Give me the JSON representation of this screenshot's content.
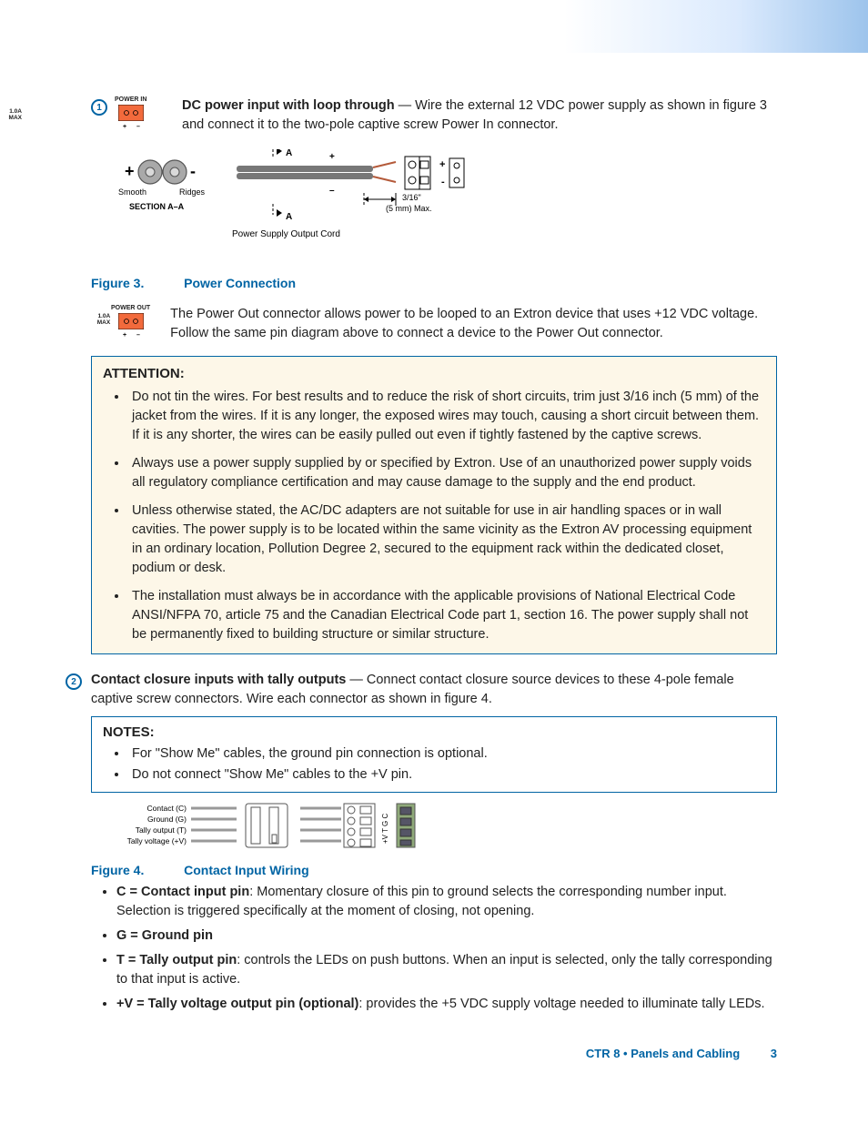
{
  "callout1": {
    "num": "1",
    "conn_label_top": "POWER IN",
    "conn_label_left": "1.0A",
    "conn_label_left2": "MAX",
    "title_bold": "DC power input with loop through",
    "title_rest": " — Wire the external 12 VDC power supply as shown in figure 3 and connect it to the two-pole captive screw Power In connector."
  },
  "figure3": {
    "left_label_smooth": "Smooth",
    "left_label_ridges": "Ridges",
    "section_label": "SECTION  A–A",
    "top_A": "A",
    "bottom_A": "A",
    "dim_line1": "3/16\"",
    "dim_line2": "(5 mm) Max.",
    "sub_caption": "Power Supply Output Cord",
    "caption_lead": "Figure 3.",
    "caption_title": "Power Connection"
  },
  "powerout": {
    "conn_label_top": "POWER OUT",
    "conn_label_left": "1.0A",
    "conn_label_left2": "MAX",
    "text": "The Power Out connector allows power to be looped to an Extron device that uses +12 VDC voltage. Follow the same pin diagram above to connect a device to the Power Out connector."
  },
  "attention": {
    "heading": "ATTENTION:",
    "items": [
      "Do not tin the wires. For best results and to reduce the risk of short circuits, trim just 3/16 inch (5 mm) of the jacket from the wires. If it is any longer, the exposed wires may touch, causing a short circuit between them. If it is any shorter, the wires can be easily pulled out even if tightly fastened by the captive screws.",
      "Always use a power supply supplied by or specified by Extron. Use of an unauthorized power supply voids all regulatory compliance certification and may cause damage to the supply and the end product.",
      "Unless otherwise stated, the AC/DC adapters are not suitable for use in air handling spaces or in wall cavities. The power supply is to be located within the same vicinity as the Extron AV processing equipment in an ordinary location, Pollution Degree 2, secured to the equipment rack within the dedicated closet, podium or desk.",
      "The installation must always be in accordance with the applicable provisions of National Electrical Code ANSI/NFPA 70, article 75 and the Canadian Electrical Code part 1, section 16. The power supply shall not be permanently fixed to building structure or similar structure."
    ]
  },
  "callout2": {
    "num": "2",
    "title_bold": "Contact closure inputs with tally outputs",
    "title_rest": " — Connect contact closure source devices to these 4-pole female captive screw connectors. Wire each connector as shown in figure 4."
  },
  "notes": {
    "heading": "NOTES:",
    "items": [
      "For \"Show Me\" cables, the ground pin connection is optional.",
      "Do not connect \"Show Me\" cables to the +V pin."
    ]
  },
  "figure4": {
    "row_labels": [
      "Contact (C)",
      "Ground (G)",
      "Tally output (T)",
      "Tally voltage (+V)"
    ],
    "term_labels": [
      "+V",
      "T",
      "G",
      "C"
    ],
    "caption_lead": "Figure 4.",
    "caption_title": "Contact Input Wiring"
  },
  "pins": [
    {
      "bold": "C = Contact input pin",
      "rest": ": Momentary closure of this pin to ground selects the corresponding number input. Selection is triggered specifically at the moment of closing, not opening."
    },
    {
      "bold": "G = Ground pin",
      "rest": ""
    },
    {
      "bold": "T = Tally output pin",
      "rest": ": controls the LEDs on push buttons. When an input is selected, only the tally corresponding to that input is active."
    },
    {
      "bold": "+V = Tally voltage output pin (optional)",
      "rest": ": provides the +5 VDC supply voltage needed to illuminate tally LEDs."
    }
  ],
  "footer": {
    "section": "CTR 8 • Panels and Cabling",
    "page": "3"
  }
}
